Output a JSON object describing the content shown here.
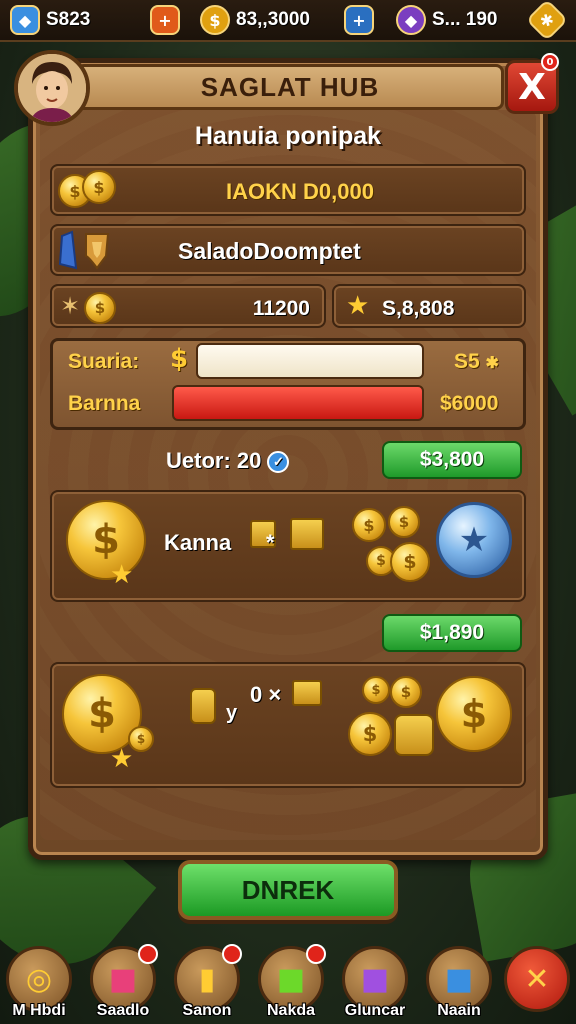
{
  "top_bar": {
    "resources": [
      {
        "icon": "blue-gem-icon",
        "value": "S823",
        "color": "#3a8fe0"
      },
      {
        "icon": "plus-icon",
        "value": "",
        "color": "#e05a1a"
      },
      {
        "icon": "gold-coin-icon",
        "value": "83,,3000",
        "color": "#e0a010"
      },
      {
        "icon": "plus-icon",
        "value": "",
        "color": "#2a6fc0"
      },
      {
        "icon": "purple-gem-icon",
        "value": "S... 190",
        "color": "#7a3ec0"
      },
      {
        "icon": "settings-icon",
        "value": "",
        "color": "#e0a010"
      }
    ]
  },
  "panel": {
    "title": "SAGLAT HUB",
    "subtitle": "Hanuia ponipak",
    "close_symbol": "X",
    "close_badge": "0",
    "rows": {
      "coins": "IAOKN D0,000",
      "shield": "SaladoDoomptet",
      "left_value": "11200",
      "right_value": "S,8,808"
    },
    "stats": {
      "row1_label": "Suaria:",
      "row1_value": "S5",
      "row2_label": "Barnna",
      "row2_value": "$6000"
    },
    "uetor": {
      "label": "Uetor: 20",
      "button": "$3,800"
    },
    "reward1": {
      "label": "Kanna",
      "multiplier": "*"
    },
    "reward2": {
      "button": "$1,890",
      "left_text": "y",
      "multiplier": "0 ×"
    },
    "main_button": "DNREK"
  },
  "bottom_nav": [
    {
      "label": "M Hbdi",
      "icon": "coin-stack-icon",
      "badge": false
    },
    {
      "label": "Saadlo",
      "icon": "gift-box-icon",
      "badge": true
    },
    {
      "label": "Sanon",
      "icon": "gold-barrel-icon",
      "badge": true
    },
    {
      "label": "Nakda",
      "icon": "green-crate-icon",
      "badge": true
    },
    {
      "label": "Gluncar",
      "icon": "purple-chest-icon",
      "badge": false
    },
    {
      "label": "Naain",
      "icon": "blue-cube-icon",
      "badge": false
    }
  ],
  "colors": {
    "accent_green": "#1f9a2a",
    "accent_red": "#c81812",
    "gold": "#ffd24a",
    "panel_brown": "#7e5430"
  }
}
